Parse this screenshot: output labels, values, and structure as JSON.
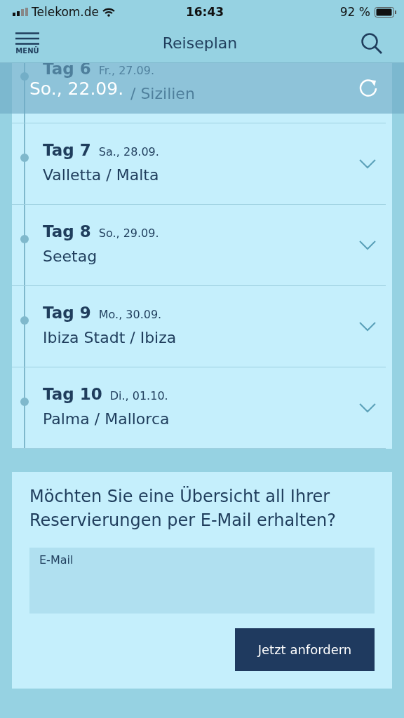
{
  "status_bar": {
    "carrier": "Telekom.de",
    "time": "16:43",
    "battery": "92 %"
  },
  "header": {
    "menu_label": "MENÜ",
    "title": "Reiseplan"
  },
  "date_bar": {
    "date": "So., 22.09."
  },
  "days": [
    {
      "kind": "covered",
      "day": "Tag 6",
      "date": "Fr., 27.09.",
      "place": "/ Sizilien"
    },
    {
      "day": "Tag 7",
      "date": "Sa., 28.09.",
      "place": "Valletta / Malta",
      "expanded": false
    },
    {
      "day": "Tag 8",
      "date": "So., 29.09.",
      "place": "Seetag",
      "expanded": false
    },
    {
      "day": "Tag 9",
      "date": "Mo., 30.09.",
      "place": "Ibiza Stadt / Ibiza",
      "expanded": false
    },
    {
      "day": "Tag 10",
      "date": "Di., 01.10.",
      "place": "Palma / Mallorca",
      "expanded": false
    }
  ],
  "email_card": {
    "heading": "Möchten Sie eine Übersicht all Ihrer Reservierungen per E-Mail erhalten?",
    "field": {
      "label": "E-Mail"
    },
    "button": "Jetzt anfordern"
  }
}
